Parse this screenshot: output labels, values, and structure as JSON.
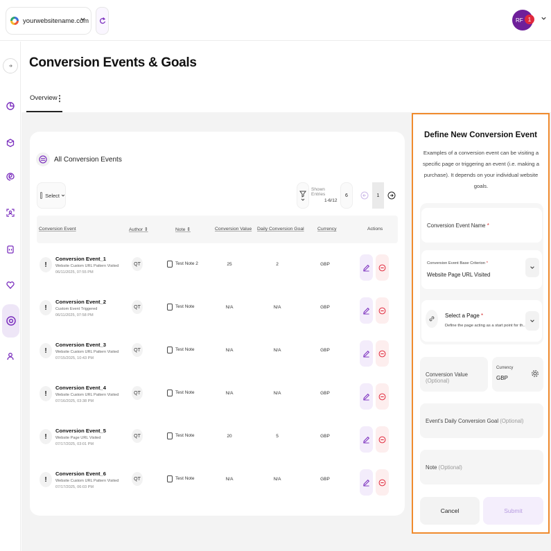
{
  "header": {
    "site_name": "yourwebsitename.com",
    "avatar_initials": "RF",
    "notification_count": "1"
  },
  "page": {
    "title": "Conversion Events & Goals",
    "tab_overview": "Overview"
  },
  "events_card": {
    "title": "All Conversion Events",
    "select_label": "Select",
    "shown_entries_label": "Shown Entries",
    "shown_entries_value": "1-6/12",
    "per_page": "6",
    "current_page": "1",
    "columns": {
      "event": "Conversion Event",
      "author": "Author",
      "note": "Note",
      "value": "Conversion Value",
      "goal": "Daily Conversion Goal",
      "currency": "Currency",
      "actions": "Actions"
    },
    "rows": [
      {
        "name": "Conversion Event_1",
        "desc": "Website Custom URL Pattern Visited",
        "date": "06/11/2025, 07:55 PM",
        "author": "QT",
        "note": "Test Note 2",
        "value": "25",
        "goal": "2",
        "currency": "GBP"
      },
      {
        "name": "Conversion Event_2",
        "desc": "Custom Event Triggered",
        "date": "06/11/2025, 07:58 PM",
        "author": "QT",
        "note": "Test Note",
        "value": "N/A",
        "goal": "N/A",
        "currency": "GBP"
      },
      {
        "name": "Conversion Event_3",
        "desc": "Website Custom URL Pattern Visited",
        "date": "07/15/2025, 10:43 PM",
        "author": "QT",
        "note": "Test Note",
        "value": "N/A",
        "goal": "N/A",
        "currency": "GBP"
      },
      {
        "name": "Conversion Event_4",
        "desc": "Website Custom URL Pattern Visited",
        "date": "07/16/2025, 03:38 PM",
        "author": "QT",
        "note": "Test Note",
        "value": "N/A",
        "goal": "N/A",
        "currency": "GBP"
      },
      {
        "name": "Conversion Event_5",
        "desc": "Website Page URL Visited",
        "date": "07/17/2025, 03:01 PM",
        "author": "QT",
        "note": "Test Note",
        "value": "20",
        "goal": "5",
        "currency": "GBP"
      },
      {
        "name": "Conversion Event_6",
        "desc": "Website Custom URL Pattern Visited",
        "date": "07/17/2025, 06:03 PM",
        "author": "QT",
        "note": "Test Note",
        "value": "N/A",
        "goal": "N/A",
        "currency": "GBP"
      }
    ]
  },
  "panel": {
    "title": "Define New Conversion Event",
    "description": "Examples of a conversion event can be visiting a specific page or triggering an event (i.e. making a purchase). It depends on your individual website goals.",
    "name_label": "Conversion Event Name",
    "criterion_label": "Conversion Event Base Criterion",
    "criterion_value": "Website Page URL Visited",
    "page_label": "Select a Page",
    "page_hint": "Define the page acting as a start point for th...",
    "value_label": "Conversion Value",
    "optional": "(Optional)",
    "currency_label": "Currency",
    "currency_value": "GBP",
    "goal_label": "Event's Daily Conversion Goal",
    "note_label": "Note",
    "required_mark": "*",
    "cancel": "Cancel",
    "submit": "Submit"
  },
  "colors": {
    "accent": "#7b2fbe",
    "panel_border": "#f08a2c",
    "delete": "#e0283c"
  }
}
